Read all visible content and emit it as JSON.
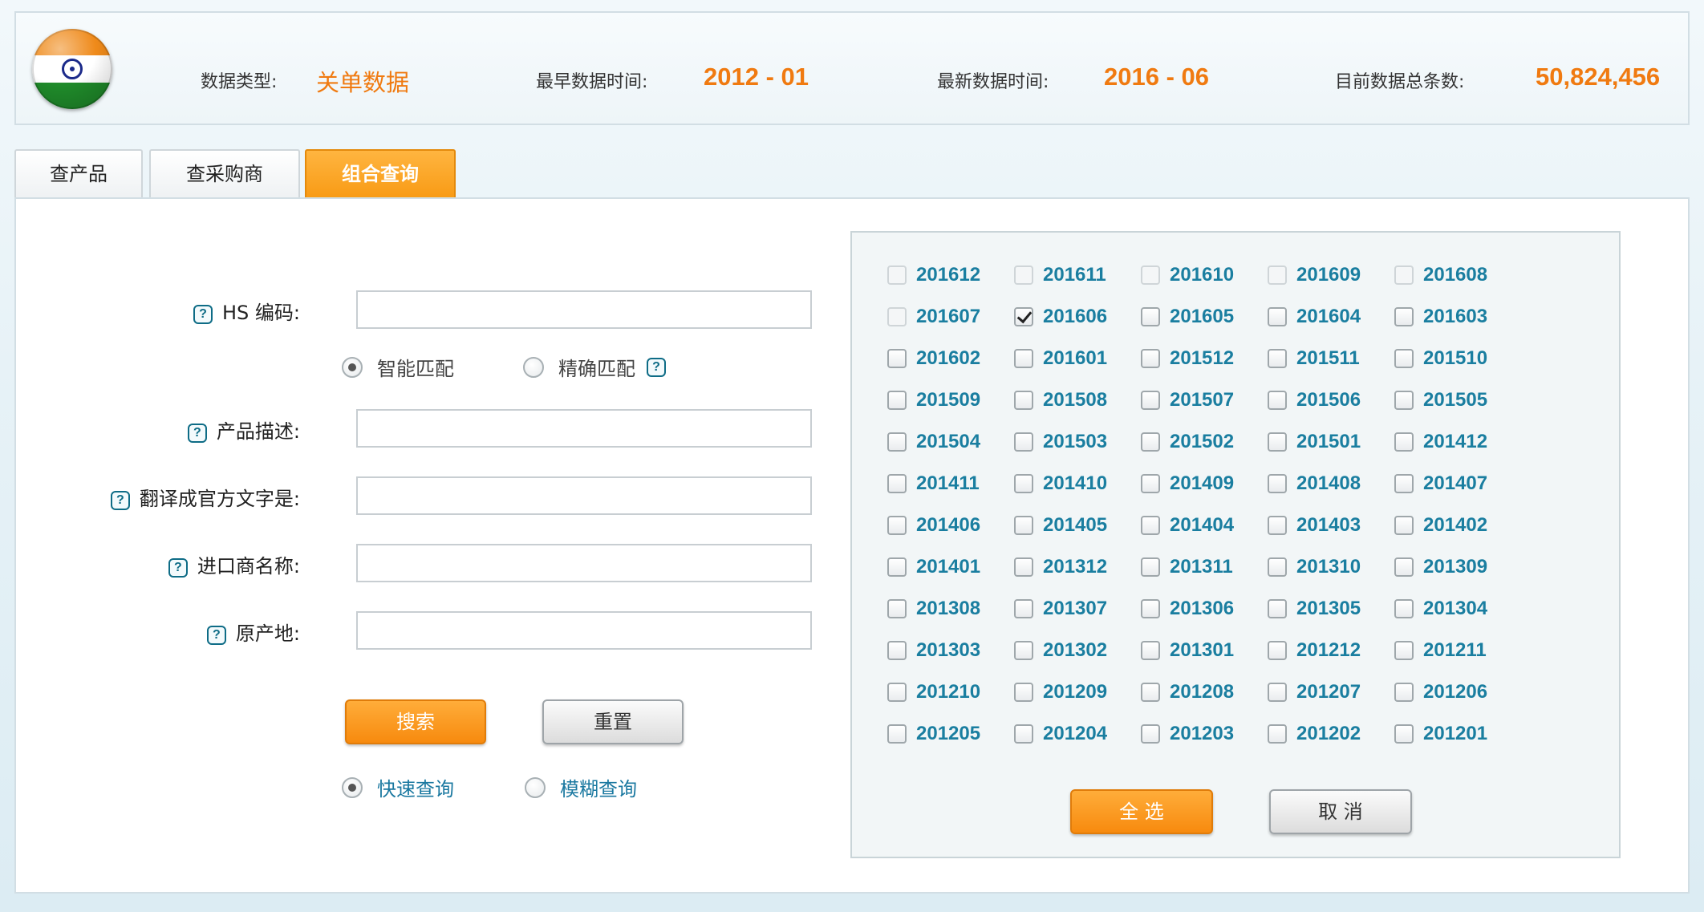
{
  "header": {
    "data_type_label": "数据类型:",
    "data_type_value": "关单数据",
    "earliest_label": "最早数据时间:",
    "earliest_value": "2012 - 01",
    "latest_label": "最新数据时间:",
    "latest_value": "2016 - 06",
    "total_label": "目前数据总条数:",
    "total_value": "50,824,456",
    "flag_icon": "india-flag-icon",
    "accent_color": "#f07a10"
  },
  "tabs": [
    {
      "label": "查产品",
      "active": false
    },
    {
      "label": "查采购商",
      "active": false
    },
    {
      "label": "组合查询",
      "active": true
    }
  ],
  "form": {
    "hs_label": "HS 编码:",
    "hs_value": "",
    "match_smart": "智能匹配",
    "match_exact": "精确匹配",
    "match_selected": "智能匹配",
    "desc_label": "产品描述:",
    "desc_value": "",
    "translate_label": "翻译成官方文字是:",
    "translate_value": "",
    "importer_label": "进口商名称:",
    "importer_value": "",
    "origin_label": "原产地:",
    "origin_value": "",
    "help_icon": "?",
    "search_button": "搜索",
    "reset_button": "重置",
    "mode_fast": "快速查询",
    "mode_fuzzy": "模糊查询",
    "mode_selected": "快速查询"
  },
  "months": {
    "items": [
      {
        "label": "201612",
        "checked": false,
        "disabled": true
      },
      {
        "label": "201611",
        "checked": false,
        "disabled": true
      },
      {
        "label": "201610",
        "checked": false,
        "disabled": true
      },
      {
        "label": "201609",
        "checked": false,
        "disabled": true
      },
      {
        "label": "201608",
        "checked": false,
        "disabled": true
      },
      {
        "label": "201607",
        "checked": false,
        "disabled": true
      },
      {
        "label": "201606",
        "checked": true,
        "disabled": false
      },
      {
        "label": "201605",
        "checked": false,
        "disabled": false
      },
      {
        "label": "201604",
        "checked": false,
        "disabled": false
      },
      {
        "label": "201603",
        "checked": false,
        "disabled": false
      },
      {
        "label": "201602",
        "checked": false,
        "disabled": false
      },
      {
        "label": "201601",
        "checked": false,
        "disabled": false
      },
      {
        "label": "201512",
        "checked": false,
        "disabled": false
      },
      {
        "label": "201511",
        "checked": false,
        "disabled": false
      },
      {
        "label": "201510",
        "checked": false,
        "disabled": false
      },
      {
        "label": "201509",
        "checked": false,
        "disabled": false
      },
      {
        "label": "201508",
        "checked": false,
        "disabled": false
      },
      {
        "label": "201507",
        "checked": false,
        "disabled": false
      },
      {
        "label": "201506",
        "checked": false,
        "disabled": false
      },
      {
        "label": "201505",
        "checked": false,
        "disabled": false
      },
      {
        "label": "201504",
        "checked": false,
        "disabled": false
      },
      {
        "label": "201503",
        "checked": false,
        "disabled": false
      },
      {
        "label": "201502",
        "checked": false,
        "disabled": false
      },
      {
        "label": "201501",
        "checked": false,
        "disabled": false
      },
      {
        "label": "201412",
        "checked": false,
        "disabled": false
      },
      {
        "label": "201411",
        "checked": false,
        "disabled": false
      },
      {
        "label": "201410",
        "checked": false,
        "disabled": false
      },
      {
        "label": "201409",
        "checked": false,
        "disabled": false
      },
      {
        "label": "201408",
        "checked": false,
        "disabled": false
      },
      {
        "label": "201407",
        "checked": false,
        "disabled": false
      },
      {
        "label": "201406",
        "checked": false,
        "disabled": false
      },
      {
        "label": "201405",
        "checked": false,
        "disabled": false
      },
      {
        "label": "201404",
        "checked": false,
        "disabled": false
      },
      {
        "label": "201403",
        "checked": false,
        "disabled": false
      },
      {
        "label": "201402",
        "checked": false,
        "disabled": false
      },
      {
        "label": "201401",
        "checked": false,
        "disabled": false
      },
      {
        "label": "201312",
        "checked": false,
        "disabled": false
      },
      {
        "label": "201311",
        "checked": false,
        "disabled": false
      },
      {
        "label": "201310",
        "checked": false,
        "disabled": false
      },
      {
        "label": "201309",
        "checked": false,
        "disabled": false
      },
      {
        "label": "201308",
        "checked": false,
        "disabled": false
      },
      {
        "label": "201307",
        "checked": false,
        "disabled": false
      },
      {
        "label": "201306",
        "checked": false,
        "disabled": false
      },
      {
        "label": "201305",
        "checked": false,
        "disabled": false
      },
      {
        "label": "201304",
        "checked": false,
        "disabled": false
      },
      {
        "label": "201303",
        "checked": false,
        "disabled": false
      },
      {
        "label": "201302",
        "checked": false,
        "disabled": false
      },
      {
        "label": "201301",
        "checked": false,
        "disabled": false
      },
      {
        "label": "201212",
        "checked": false,
        "disabled": false
      },
      {
        "label": "201211",
        "checked": false,
        "disabled": false
      },
      {
        "label": "201210",
        "checked": false,
        "disabled": false
      },
      {
        "label": "201209",
        "checked": false,
        "disabled": false
      },
      {
        "label": "201208",
        "checked": false,
        "disabled": false
      },
      {
        "label": "201207",
        "checked": false,
        "disabled": false
      },
      {
        "label": "201206",
        "checked": false,
        "disabled": false
      },
      {
        "label": "201205",
        "checked": false,
        "disabled": false
      },
      {
        "label": "201204",
        "checked": false,
        "disabled": false
      },
      {
        "label": "201203",
        "checked": false,
        "disabled": false
      },
      {
        "label": "201202",
        "checked": false,
        "disabled": false
      },
      {
        "label": "201201",
        "checked": false,
        "disabled": false
      }
    ],
    "select_all_button": "全 选",
    "cancel_button": "取 消"
  }
}
